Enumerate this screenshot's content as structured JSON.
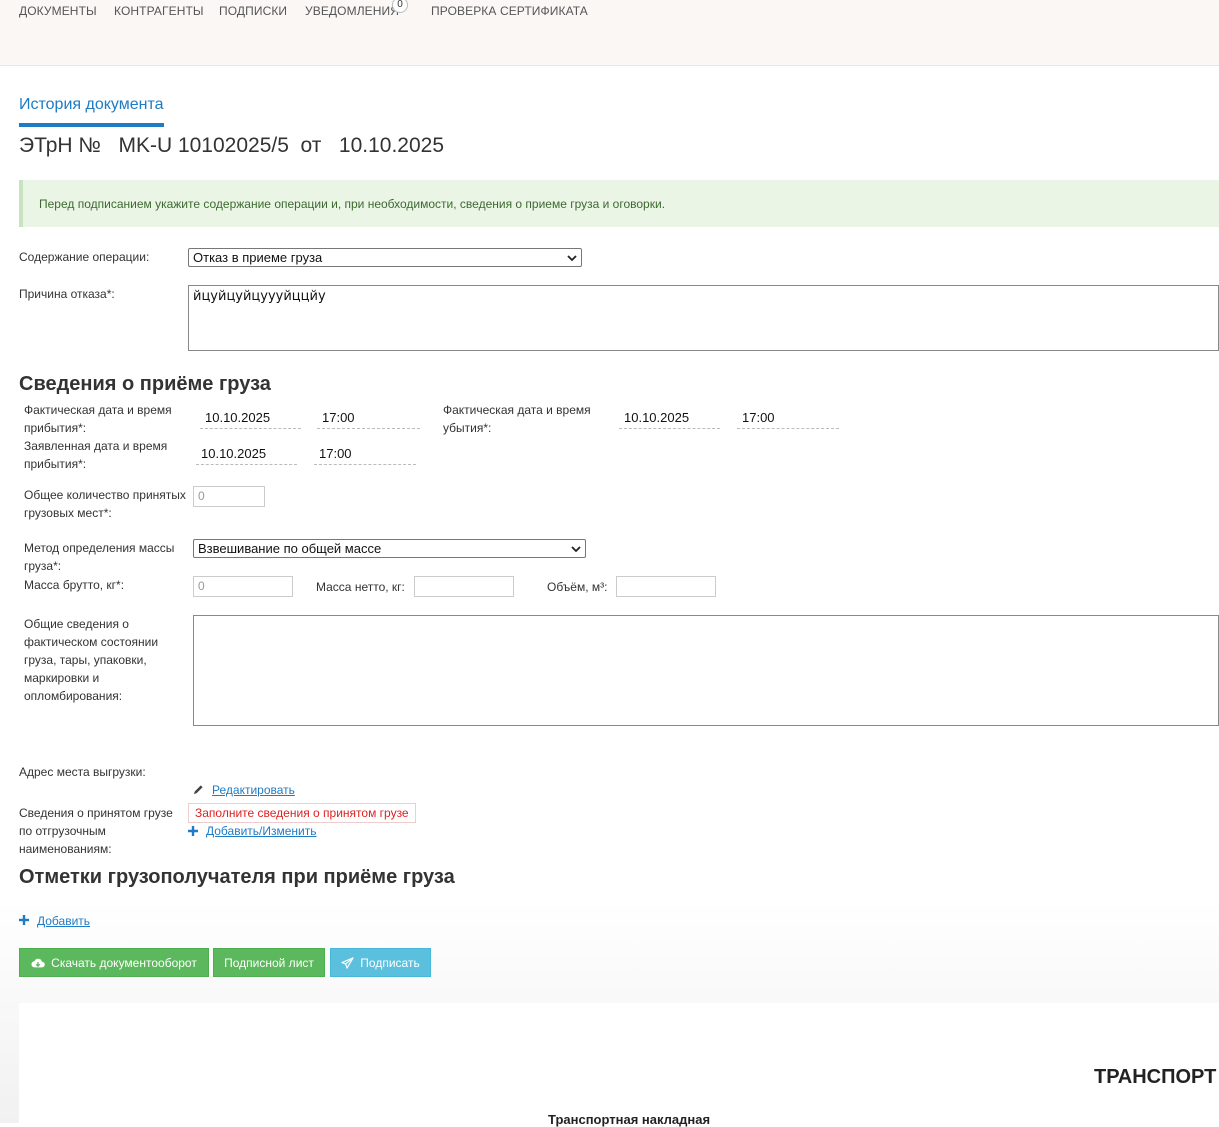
{
  "nav": {
    "items": [
      "ДОКУМЕНТЫ",
      "КОНТРАГЕНТЫ",
      "ПОДПИСКИ",
      "УВЕДОМЛЕНИЯ",
      "ПРОВЕРКА СЕРТИФИКАТА"
    ],
    "notifications_count": "0"
  },
  "tab": {
    "label": "История документа"
  },
  "doc": {
    "title": "ЭТрН №   MK-U 10102025/5  от   10.10.2025"
  },
  "alert": {
    "text": "Перед подписанием укажите содержание операции и, при необходимости, сведения о приеме груза и оговорки."
  },
  "operation": {
    "label": "Содержание операции:",
    "value": "Отказ в приеме груза",
    "reason_label": "Причина отказа*:",
    "reason_value": "йцуйцуйцуууйццйу"
  },
  "cargo": {
    "heading": "Сведения о приёме груза",
    "arrival_actual_label_1": "Фактическая дата и время",
    "arrival_actual_label_2": "прибытия*:",
    "arrival_actual_date": "10.10.2025",
    "arrival_actual_time": "17:00",
    "departure_actual_label_1": "Фактическая дата и время",
    "departure_actual_label_2": "убытия*:",
    "departure_actual_date": "10.10.2025",
    "departure_actual_time": "17:00",
    "arrival_declared_label_1": "Заявленная дата и время",
    "arrival_declared_label_2": "прибытия*:",
    "arrival_declared_date": "10.10.2025",
    "arrival_declared_time": "17:00",
    "places_label_1": "Общее количество принятых",
    "places_label_2": "грузовых мест*:",
    "places_value": "0",
    "mass_method_label_1": "Метод определения массы",
    "mass_method_label_2": "груза*:",
    "mass_method_value": "Взвешивание по общей массе",
    "gross_label": "Масса брутто, кг*:",
    "gross_value": "0",
    "net_label": "Масса нетто, кг:",
    "volume_label": "Объём, м³:",
    "condition_label": [
      "Общие сведения о",
      "фактическом состоянии",
      "груза, тары, упаковки,",
      "маркировки и",
      "опломбирования:"
    ],
    "unload_address_label": "Адрес места выгрузки:",
    "edit_link": "Редактировать",
    "accepted_label": [
      "Сведения о принятом грузе",
      "по отгрузочным",
      "наименованиям:"
    ],
    "accepted_error": "Заполните сведения о принятом грузе",
    "add_change_link": "Добавить/Изменить"
  },
  "marks": {
    "heading": "Отметки грузополучателя при приёме груза",
    "add_link": "Добавить"
  },
  "buttons": {
    "download": "Скачать документооборот",
    "sign_sheet": "Подписной лист",
    "sign": "Подписать"
  },
  "paper": {
    "heading": "ТРАНСПОРТ",
    "subheading": "Транспортная накладная"
  },
  "colors": {
    "accent": "#1e7bc4",
    "success": "#5cb85c",
    "info": "#5bc0de",
    "error": "#dd2222"
  }
}
